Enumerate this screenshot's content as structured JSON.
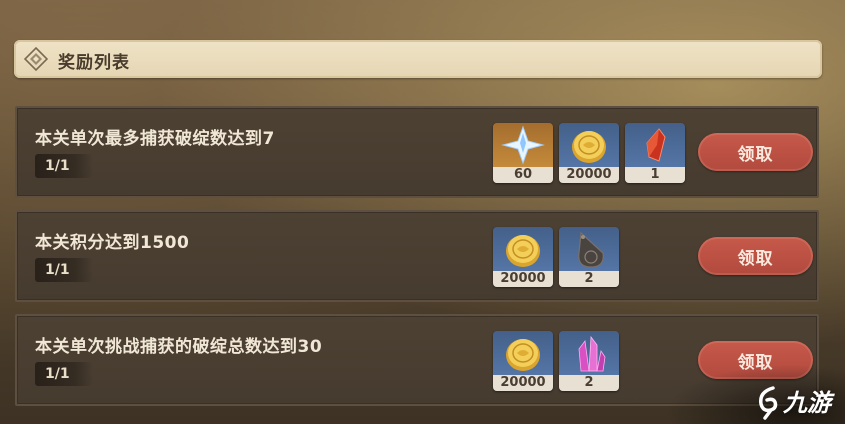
{
  "header": {
    "title": "奖励列表",
    "icon": "diamond-ornament-icon"
  },
  "tasks": [
    {
      "description": "本关单次最多捕获破绽数达到7",
      "progress": "1/1",
      "rewards": [
        {
          "icon": "primogem-icon",
          "count": "60"
        },
        {
          "icon": "mora-coin-icon",
          "count": "20000"
        },
        {
          "icon": "red-crystal-icon",
          "count": "1"
        }
      ],
      "claim_label": "领取"
    },
    {
      "description": "本关积分达到1500",
      "progress": "1/1",
      "rewards": [
        {
          "icon": "mora-coin-icon",
          "count": "20000"
        },
        {
          "icon": "drop-pendant-icon",
          "count": "2"
        }
      ],
      "claim_label": "领取"
    },
    {
      "description": "本关单次挑战捕获的破绽总数达到30",
      "progress": "1/1",
      "rewards": [
        {
          "icon": "mora-coin-icon",
          "count": "20000"
        },
        {
          "icon": "pink-crystal-cluster-icon",
          "count": "2"
        }
      ],
      "claim_label": "领取"
    }
  ],
  "watermark": {
    "text": "九游"
  },
  "colors": {
    "claim_button": "#be5446",
    "header_bg": "#e9dcbd",
    "row_bg": "#4a3e31"
  }
}
